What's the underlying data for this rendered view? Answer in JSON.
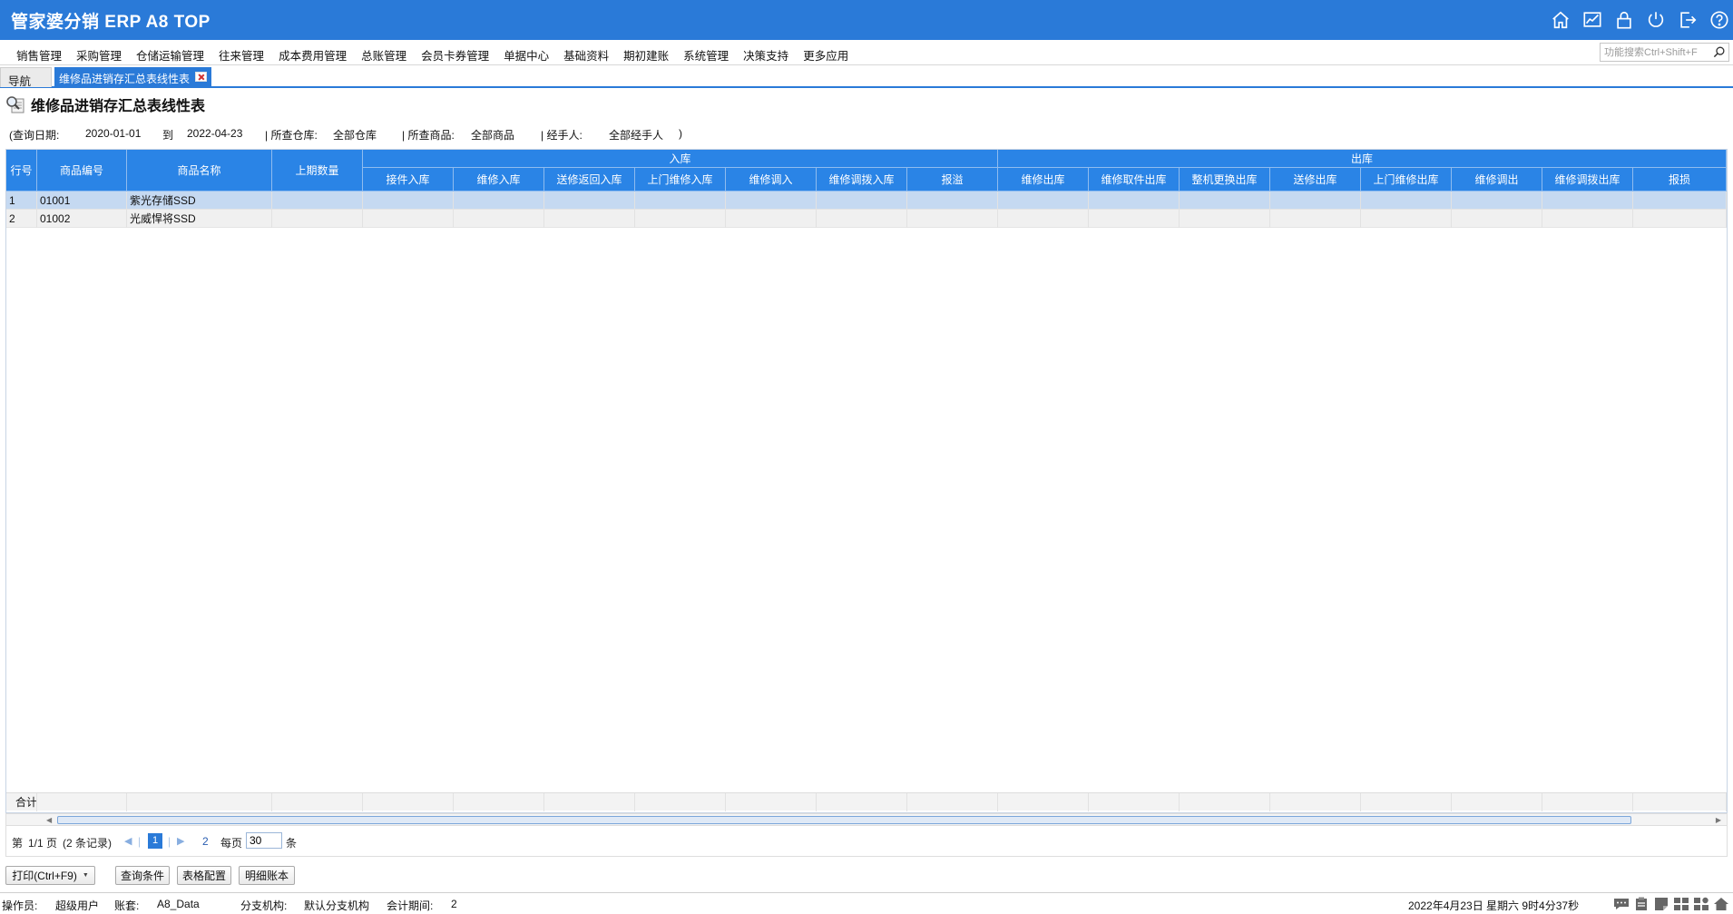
{
  "app": {
    "title": "管家婆分销 ERP A8 TOP"
  },
  "titlebar_icons": [
    "home-icon",
    "chart-icon",
    "lock-icon",
    "power-icon",
    "logout-icon",
    "help-icon"
  ],
  "menu": {
    "items": [
      "销售管理",
      "采购管理",
      "仓储运输管理",
      "往来管理",
      "成本费用管理",
      "总账管理",
      "会员卡券管理",
      "单据中心",
      "基础资料",
      "期初建账",
      "系统管理",
      "决策支持",
      "更多应用"
    ],
    "search_placeholder": "功能搜索Ctrl+Shift+F"
  },
  "tabs": {
    "nav": "导航",
    "active": "维修品进销存汇总表线性表"
  },
  "report": {
    "title": "维修品进销存汇总表线性表",
    "criteria": {
      "date_label": "(查询日期:",
      "date_from": "2020-01-01",
      "to_label": "到",
      "date_to": "2022-04-23",
      "warehouse_label": "| 所查仓库:",
      "warehouse": "全部仓库",
      "product_label": "| 所查商品:",
      "product": "全部商品",
      "handler_label": "| 经手人:",
      "handler": "全部经手人",
      "end": ")"
    }
  },
  "table": {
    "fixed_headers": [
      "行号",
      "商品编号",
      "商品名称",
      "上期数量"
    ],
    "group_in": "入库",
    "in_columns": [
      "接件入库",
      "维修入库",
      "送修返回入库",
      "上门维修入库",
      "维修调入",
      "维修调拨入库",
      "报溢"
    ],
    "group_out": "出库",
    "out_columns": [
      "维修出库",
      "维修取件出库",
      "整机更换出库",
      "送修出库",
      "上门维修出库",
      "维修调出",
      "维修调拨出库",
      "报损"
    ],
    "rows": [
      {
        "no": "1",
        "code": "01001",
        "name": "紫光存储SSD"
      },
      {
        "no": "2",
        "code": "01002",
        "name": "光威悍将SSD"
      }
    ],
    "total_label": "合计"
  },
  "pager": {
    "page_prefix": "第",
    "page_info": "1/1 页",
    "record_info": "(2 条记录)",
    "current_page": "1",
    "next_page_link": "2",
    "per_page_label": "每页",
    "per_page_value": "30",
    "per_page_suffix": "条"
  },
  "buttons": {
    "print": "打印(Ctrl+F9)",
    "query": "查询条件",
    "table_config": "表格配置",
    "detail": "明细账本"
  },
  "status": {
    "operator_label": "操作员:",
    "operator": "超级用户",
    "account_label": "账套:",
    "account": "A8_Data",
    "branch_label": "分支机构:",
    "branch": "默认分支机构",
    "period_label": "会计期间:",
    "period": "2",
    "datetime": "2022年4月23日  星期六  9时4分37秒"
  },
  "colors": {
    "brand": "#2a7ad8",
    "header": "#2a84e6",
    "selected_row": "#c5d9f1"
  }
}
